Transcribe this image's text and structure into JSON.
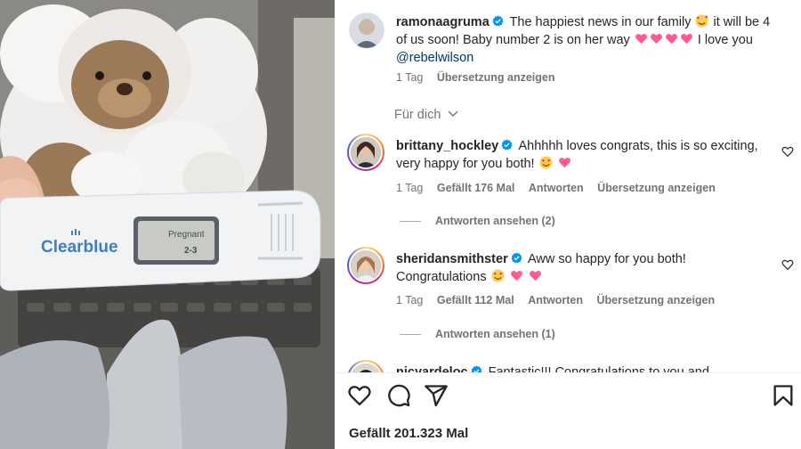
{
  "post": {
    "author": "ramonaagruma",
    "caption": "The happiest news in our family",
    "caption_cont": "it will be 4 of us soon! Baby number 2 is on her way",
    "caption_end": "I love you",
    "mention": "@rebelwilson",
    "time": "1 Tag",
    "translate": "Übersetzung anzeigen"
  },
  "for_you_label": "Für dich",
  "comments": [
    {
      "user": "brittany_hockley",
      "text": "Ahhhhh loves congrats, this is so exciting, very happy for you both!",
      "time": "1 Tag",
      "likes": "Gefällt 176 Mal",
      "reply": "Antworten",
      "translate": "Übersetzung anzeigen",
      "view_replies": "Antworten ansehen (2)"
    },
    {
      "user": "sheridansmithster",
      "text": "Aww so happy for you both! Congratulations",
      "time": "1 Tag",
      "likes": "Gefällt 112 Mal",
      "reply": "Antworten",
      "translate": "Übersetzung anzeigen",
      "view_replies": "Antworten ansehen (1)"
    },
    {
      "user": "nicyardeloc",
      "text": "Fantastic!!! Congratulations to you and"
    }
  ],
  "likes_count": "Gefällt 201.323 Mal",
  "image": {
    "brand": "Clearblue",
    "display_line1": "Pregnant",
    "display_line2": "2-3"
  },
  "colors": {
    "heart": "#ed2f5b",
    "verified": "#0095f6",
    "link": "#00376b",
    "muted": "#737373"
  },
  "icons": [
    "heart-icon",
    "comment-icon",
    "share-icon",
    "bookmark-icon",
    "verified-icon",
    "chevron-down-icon"
  ]
}
